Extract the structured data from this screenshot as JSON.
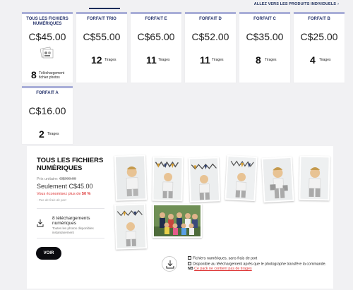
{
  "top_link": "ALLEZ VERS LES PRODUITS INDIVIDUELS",
  "top_link_arrow": "›",
  "cards": [
    {
      "name": "TOUS LES FICHIERS NUMÉRIQUES",
      "price": "C$45.00",
      "count": "8",
      "unit": "Téléchargement fichier photos",
      "icon": "photo-files-icon"
    },
    {
      "name": "FORFAIT TRIO",
      "price": "C$55.00",
      "count": "12",
      "unit": "Tirages"
    },
    {
      "name": "FORFAIT E",
      "price": "C$65.00",
      "count": "11",
      "unit": "Tirages"
    },
    {
      "name": "FORFAIT D",
      "price": "C$52.00",
      "count": "11",
      "unit": "Tirages"
    },
    {
      "name": "FORFAIT C",
      "price": "C$35.00",
      "count": "8",
      "unit": "Tirages"
    },
    {
      "name": "FORFAIT B",
      "price": "C$25.00",
      "count": "4",
      "unit": "Tirages"
    },
    {
      "name": "FORFAIT A",
      "price": "C$16.00",
      "count": "2",
      "unit": "Tirages"
    }
  ],
  "detail": {
    "title": "TOUS LES FICHIERS NUMÉRIQUES",
    "unit_price_label": "Prix unitaire:",
    "unit_price_old": "C$200.00",
    "new_price": "Seulement C$45.00",
    "savings_prefix": "Vous économisez plus de",
    "savings_pct": "50 %",
    "shipping_note": "- Pas de frais de port",
    "download_title": "8 téléchargements numériques",
    "download_sub": "Toutes les photos disponibles instantanément",
    "voir_label": "VOIR",
    "notes": [
      "Fichiers numériques, sans frais de port",
      "Disponible au téléchargement après que le photographe transfère la commande."
    ],
    "nb_label": "NB",
    "nb_text": "Ce pack ne contient pas de tirages"
  },
  "colors": {
    "accent": "#26336b",
    "card_top_border": "#a9aed8",
    "warning": "#d33333",
    "button_bg": "#0b0b10"
  }
}
